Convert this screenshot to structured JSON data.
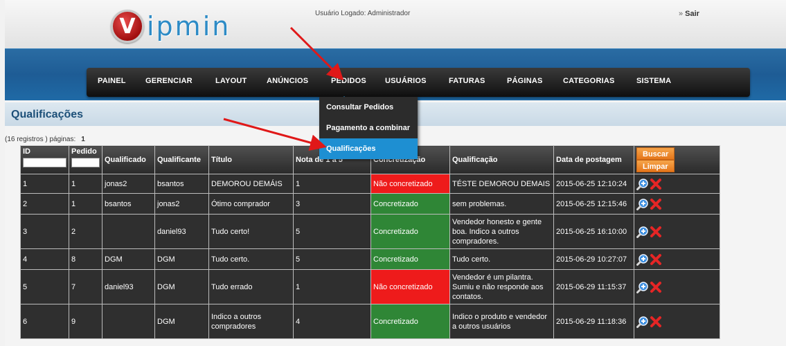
{
  "header": {
    "logo_initial": "V",
    "logo_text": "ipmin",
    "logged_user": "Usuário Logado: Administrador",
    "logout_label": "Sair"
  },
  "nav": {
    "items": [
      "PAINEL",
      "GERENCIAR",
      "LAYOUT",
      "ANÚNCIOS",
      "PEDIDOS",
      "USUÁRIOS",
      "FATURAS",
      "PÁGINAS",
      "CATEGORIAS",
      "SISTEMA"
    ],
    "active": "PEDIDOS"
  },
  "dropdown": {
    "items": [
      "Consultar Pedidos",
      "Pagamento a combinar",
      "Qualificações"
    ],
    "selected": "Qualificações"
  },
  "page": {
    "title": "Qualificações",
    "records_text": "(16 registros ) páginas:",
    "page_number": "1"
  },
  "table": {
    "columns": [
      "ID",
      "Pedido",
      "Qualificado",
      "Qualificante",
      "Título",
      "Nota de 1 a 5",
      "Concretização",
      "Qualificação",
      "Data de postagem"
    ],
    "search_label": "Buscar",
    "clear_label": "Limpar",
    "rows": [
      {
        "id": "1",
        "order": "1",
        "rated": "jonas2",
        "rater": "bsantos",
        "title": "DEMOROU DEMÁIS",
        "score": "1",
        "status": "Não concretizado",
        "status_color": "red",
        "comment": "TÉSTE DEMOROU DEMAIS",
        "date": "2015-06-25 12:10:24"
      },
      {
        "id": "2",
        "order": "1",
        "rated": "bsantos",
        "rater": "jonas2",
        "title": "Ótimo comprador",
        "score": "3",
        "status": "Concretizado",
        "status_color": "green",
        "comment": "sem problemas.",
        "date": "2015-06-25 12:15:46"
      },
      {
        "id": "3",
        "order": "2",
        "rated": "",
        "rater": "daniel93",
        "title": "Tudo certo!",
        "score": "5",
        "status": "Concretizado",
        "status_color": "green",
        "comment": "Vendedor honesto e gente boa. Indico a outros compradores.",
        "date": "2015-06-25 16:10:00"
      },
      {
        "id": "4",
        "order": "8",
        "rated": "DGM",
        "rater": "DGM",
        "title": "Tudo certo.",
        "score": "5",
        "status": "Concretizado",
        "status_color": "green",
        "comment": "Tudo certo.",
        "date": "2015-06-29 10:27:07"
      },
      {
        "id": "5",
        "order": "7",
        "rated": "daniel93",
        "rater": "DGM",
        "title": "Tudo errado",
        "score": "1",
        "status": "Não concretizado",
        "status_color": "red",
        "comment": "Vendedor é um pilantra. Sumiu e não responde aos contatos.",
        "date": "2015-06-29 11:15:37"
      },
      {
        "id": "6",
        "order": "9",
        "rated": "",
        "rater": "DGM",
        "title": "Indico a outros compradores",
        "score": "4",
        "status": "Concretizado",
        "status_color": "green",
        "comment": "Indico o produto e vendedor a outros usuários",
        "date": "2015-06-29 11:18:36"
      }
    ]
  },
  "colors": {
    "band": "#1e5c95",
    "selected": "#1e8fd2",
    "not_done": "#ee1b1b",
    "done": "#2f8636",
    "button": "#e4751a",
    "arrow": "#e01818"
  },
  "icons": {
    "view": "zoom-icon",
    "delete": "delete-icon"
  }
}
